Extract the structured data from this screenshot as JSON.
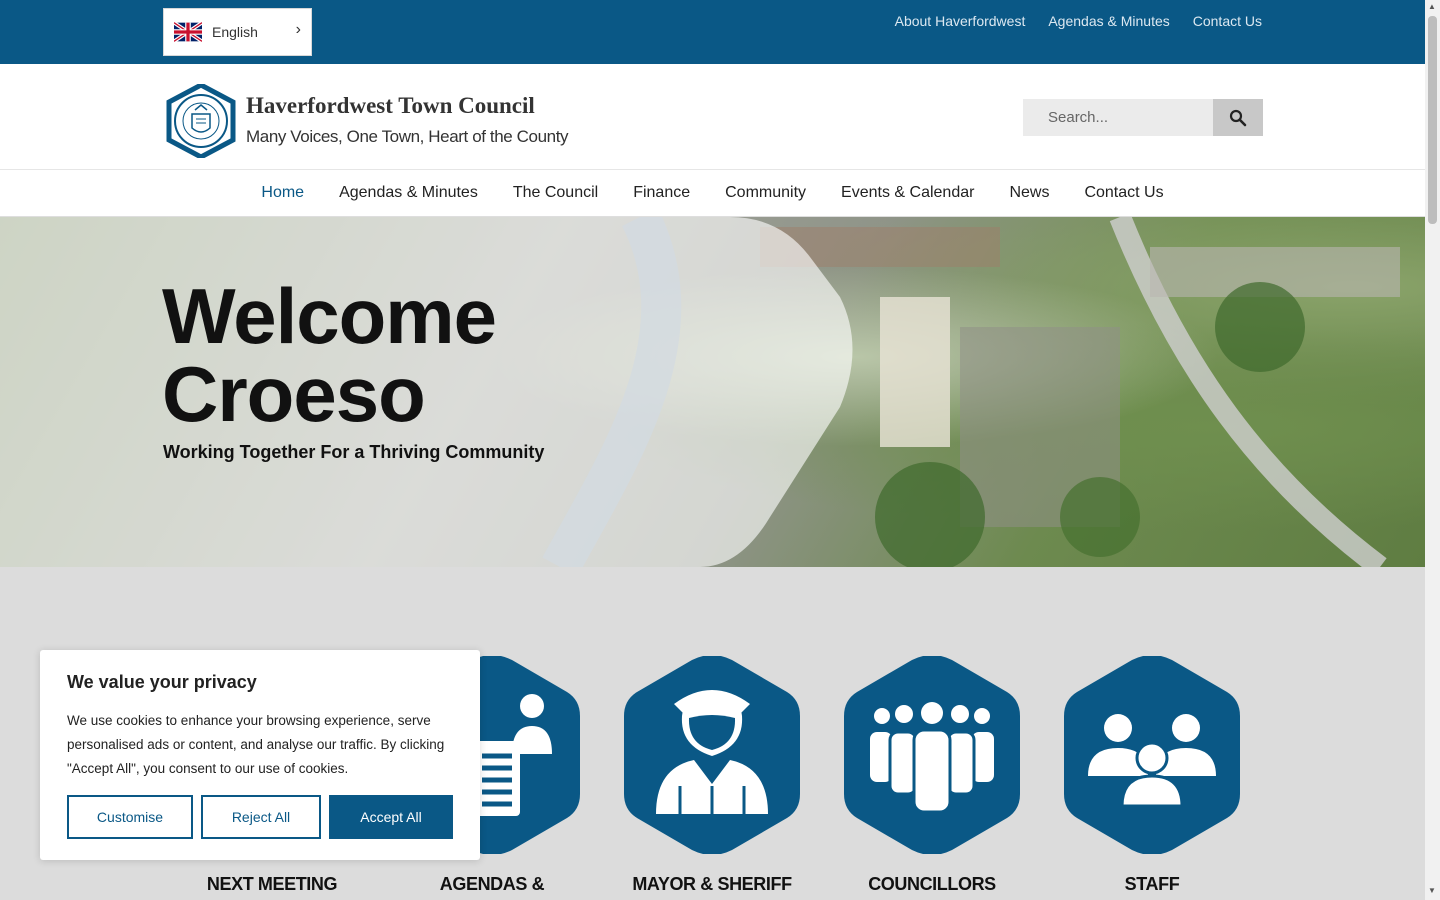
{
  "language": {
    "label": "English",
    "flag": "uk-flag-icon"
  },
  "toplinks": [
    "About Haverfordwest",
    "Agendas & Minutes",
    "Contact Us"
  ],
  "header": {
    "title": "Haverfordwest Town Council",
    "tagline": "Many Voices, One Town, Heart of the County",
    "search_placeholder": "Search..."
  },
  "nav": {
    "items": [
      "Home",
      "Agendas & Minutes",
      "The Council",
      "Finance",
      "Community",
      "Events & Calendar",
      "News",
      "Contact Us"
    ],
    "active": "Home"
  },
  "hero": {
    "line1": "Welcome",
    "line2": "Croeso",
    "subtitle": "Working Together For a Thriving Community"
  },
  "tiles": [
    {
      "label": "NEXT MEETING",
      "icon": "calendar-icon"
    },
    {
      "label": "AGENDAS &",
      "icon": "documents-icon"
    },
    {
      "label": "MAYOR & SHERIFF",
      "icon": "mayor-icon"
    },
    {
      "label": "COUNCILLORS",
      "icon": "councillors-icon"
    },
    {
      "label": "STAFF",
      "icon": "staff-icon"
    }
  ],
  "cookie": {
    "title": "We value your privacy",
    "body": "We use cookies to enhance your browsing experience, serve personalised ads or content, and analyse our traffic. By clicking \"Accept All\", you consent to our use of cookies.",
    "customise": "Customise",
    "reject": "Reject All",
    "accept": "Accept All"
  },
  "colors": {
    "brand": "#0a5886",
    "panel": "#dcdcdc"
  }
}
